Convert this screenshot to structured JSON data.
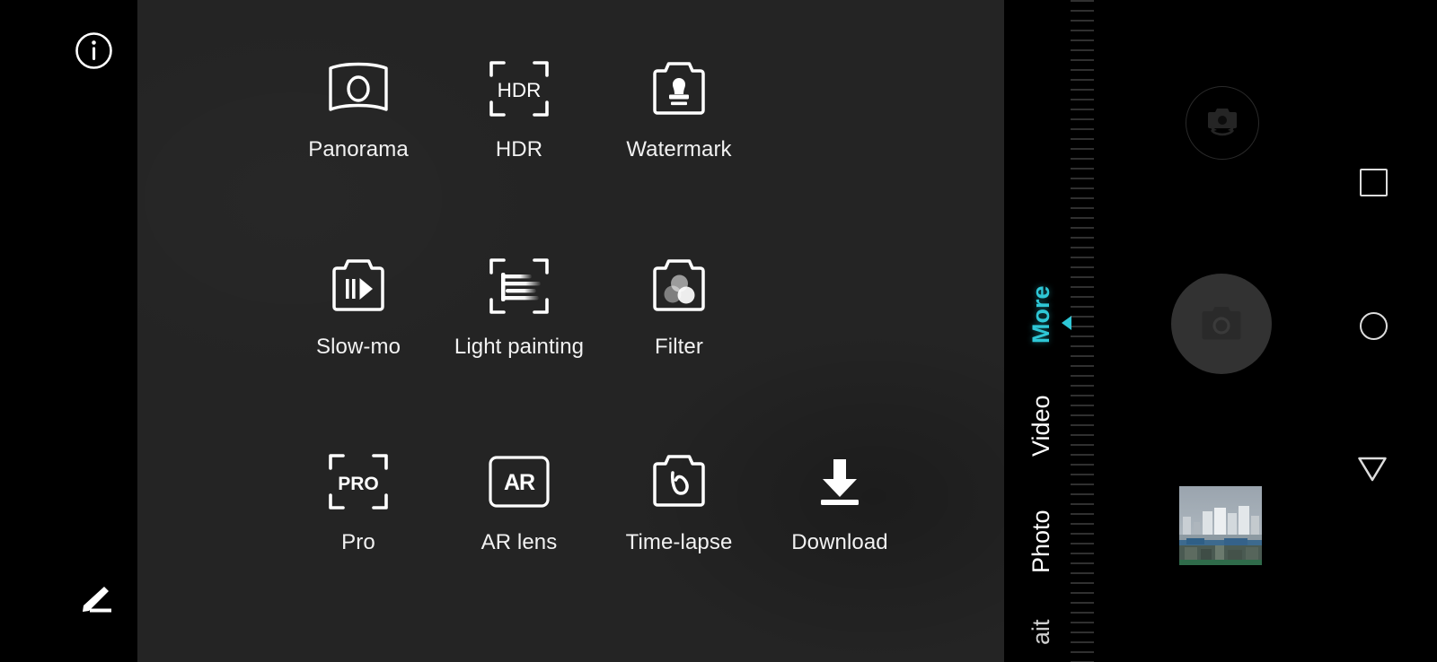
{
  "app": {
    "name": "Camera",
    "screen_title": "More camera modes"
  },
  "colors": {
    "accent": "#2ec7d6",
    "panel_bg": "#242424",
    "screen_bg": "#000000",
    "label_text": "#f2f2f2",
    "shutter_fill": "#323232",
    "nav_icon": "#dcdcdc"
  },
  "left_rail": {
    "info_button": {
      "icon": "info-circle-icon",
      "label": "Info"
    },
    "edit_button": {
      "icon": "pencil-edit-icon",
      "label": "Edit modes"
    }
  },
  "mode_grid": {
    "rows": 3,
    "columns": 4,
    "items": [
      {
        "id": "panorama",
        "label": "Panorama",
        "icon": "panorama-icon",
        "row": 1,
        "col": 1
      },
      {
        "id": "hdr",
        "label": "HDR",
        "icon": "hdr-bracket-icon",
        "row": 1,
        "col": 2
      },
      {
        "id": "watermark",
        "label": "Watermark",
        "icon": "watermark-stamp-icon",
        "row": 1,
        "col": 3
      },
      {
        "id": "slow_mo",
        "label": "Slow-mo",
        "icon": "slow-motion-icon",
        "row": 2,
        "col": 1
      },
      {
        "id": "light_painting",
        "label": "Light painting",
        "icon": "light-painting-icon",
        "row": 2,
        "col": 2
      },
      {
        "id": "filter",
        "label": "Filter",
        "icon": "filter-icon",
        "row": 2,
        "col": 3
      },
      {
        "id": "pro",
        "label": "Pro",
        "icon": "pro-bracket-icon",
        "row": 3,
        "col": 1
      },
      {
        "id": "ar_lens",
        "label": "AR lens",
        "icon": "ar-lens-icon",
        "row": 3,
        "col": 2
      },
      {
        "id": "time_lapse",
        "label": "Time-lapse",
        "icon": "time-lapse-icon",
        "row": 3,
        "col": 3
      },
      {
        "id": "download",
        "label": "Download",
        "icon": "download-arrow-icon",
        "row": 3,
        "col": 4
      }
    ]
  },
  "mode_selector": {
    "active": "More",
    "tabs": [
      {
        "label": "More",
        "active": true,
        "truncated": false
      },
      {
        "label": "Video",
        "active": false,
        "truncated": false
      },
      {
        "label": "Photo",
        "active": false,
        "truncated": false
      },
      {
        "label": "ait",
        "active": false,
        "truncated": true
      }
    ],
    "pointer_icon": "triangle-left-indicator"
  },
  "controls": {
    "switch_camera": {
      "icon": "camera-flip-icon",
      "label": "Switch camera"
    },
    "shutter": {
      "icon": "camera-shutter-icon",
      "label": "Shutter"
    },
    "gallery": {
      "icon": "gallery-thumbnail",
      "label": "Last photo: cityscape"
    }
  },
  "navigation_bar": {
    "recents": {
      "icon": "square-recents-icon",
      "label": "Recents"
    },
    "home": {
      "icon": "circle-home-icon",
      "label": "Home"
    },
    "back": {
      "icon": "triangle-back-icon",
      "label": "Back"
    }
  }
}
